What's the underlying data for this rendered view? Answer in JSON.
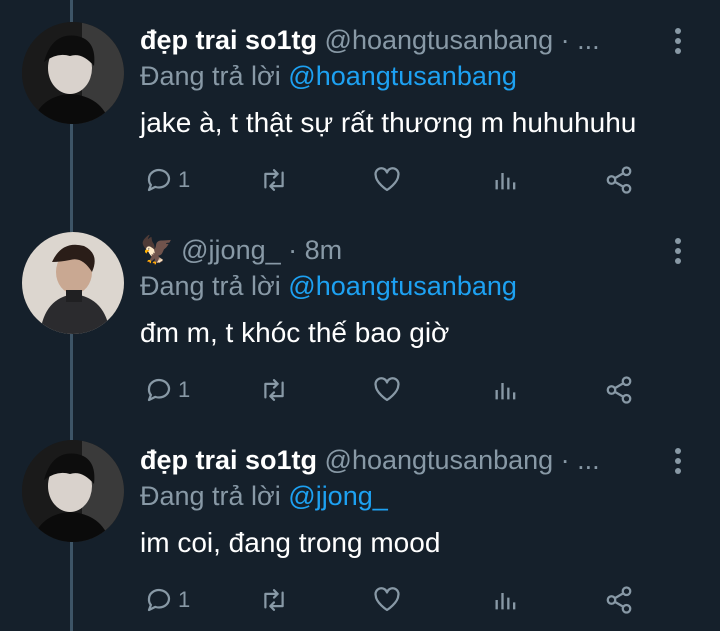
{
  "tweets": [
    {
      "display_name": "đẹp trai so1tg",
      "handle": "@hoangtusanbang · ...",
      "replying_prefix": "Đang trả lời",
      "replying_to": "@hoangtusanbang",
      "text": "jake à, t thật sự rất thương m huhuhuhu",
      "reply_count": "1",
      "avatar": "avatar-1"
    },
    {
      "display_name": "🦅",
      "handle": "@jjong_ · 8m",
      "replying_prefix": "Đang trả lời",
      "replying_to": "@hoangtusanbang",
      "text": "đm m, t khóc thế bao giờ",
      "reply_count": "1",
      "avatar": "avatar-2"
    },
    {
      "display_name": "đẹp trai so1tg",
      "handle": "@hoangtusanbang · ...",
      "replying_prefix": "Đang trả lời",
      "replying_to": "@jjong_",
      "text": "im coi, đang trong mood",
      "reply_count": "1",
      "avatar": "avatar-1"
    }
  ],
  "icons": [
    "reply-icon",
    "retweet-icon",
    "like-icon",
    "analytics-icon",
    "share-icon",
    "more-icon"
  ],
  "colors": {
    "background": "#15202b",
    "muted": "#8899a6",
    "mention": "#1da1f2",
    "thread_line": "#3d5466"
  }
}
